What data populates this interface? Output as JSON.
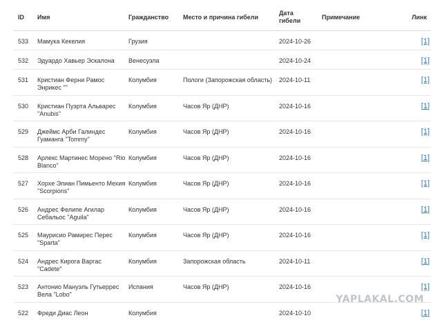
{
  "table": {
    "headers": {
      "id": "ID",
      "name": "Имя",
      "citizenship": "Гражданство",
      "place": "Место и причина гибели",
      "date_line1": "Дата",
      "date_line2": "гибели",
      "note": "Примечание",
      "link": "Линк"
    },
    "rows": [
      {
        "id": "533",
        "name": "Мамука Кекелия",
        "citizenship": "Грузия",
        "place": "",
        "date": "2024-10-26",
        "note": "",
        "link": "[1]"
      },
      {
        "id": "532",
        "name": "Эдуардо Хавьер Эскалона",
        "citizenship": "Венесуэла",
        "place": "",
        "date": "2024-10-24",
        "note": "",
        "link": "[1]"
      },
      {
        "id": "531",
        "name": "Кристиан Ферни Рамос Энрикес \"\"",
        "citizenship": "Колумбия",
        "place": "Пологи (Запорожская область)",
        "date": "2024-10-11",
        "note": "",
        "link": "[1]"
      },
      {
        "id": "530",
        "name": "Кристиан Пуэрта Альварес \"Anubis\"",
        "citizenship": "Колумбия",
        "place": "Часов Яр (ДНР)",
        "date": "2024-10-16",
        "note": "",
        "link": "[1]"
      },
      {
        "id": "529",
        "name": "Джеймс Арби Галиндес Гуаманга \"Tommy\"",
        "citizenship": "Колумбия",
        "place": "Часов Яр (ДНР)",
        "date": "2024-10-16",
        "note": "",
        "link": "[1]"
      },
      {
        "id": "528",
        "name": "Арлекс Мартинес Морено \"Rio Blanco\"",
        "citizenship": "Колумбия",
        "place": "Часов Яр (ДНР)",
        "date": "2024-10-16",
        "note": "",
        "link": "[1]"
      },
      {
        "id": "527",
        "name": "Хорхе Элиан Пимьенто Мехия \"Scorpions\"",
        "citizenship": "Колумбия",
        "place": "Часов Яр (ДНР)",
        "date": "2024-10-16",
        "note": "",
        "link": "[1]"
      },
      {
        "id": "526",
        "name": "Андрес Фелипе Агилар Себальос \"Aguila\"",
        "citizenship": "Колумбия",
        "place": "Часов Яр (ДНР)",
        "date": "2024-10-16",
        "note": "",
        "link": "[1]"
      },
      {
        "id": "525",
        "name": "Маурисио Рамирес Перес \"Sparta\"",
        "citizenship": "Колумбия",
        "place": "Часов Яр (ДНР)",
        "date": "2024-10-16",
        "note": "",
        "link": "[1]"
      },
      {
        "id": "524",
        "name": "Андрес Кирога Варгас \"Cadete\"",
        "citizenship": "Колумбия",
        "place": "Запорожская область",
        "date": "2024-10-11",
        "note": "",
        "link": "[1]"
      },
      {
        "id": "523",
        "name": "Антонио Мануэль Гутьеррес Вела \"Lobo\"",
        "citizenship": "Испания",
        "place": "Часов Яр (ДНР)",
        "date": "2024-10-16",
        "note": "",
        "link": "[1]"
      },
      {
        "id": "522",
        "name": "Фреди Диас Леон",
        "citizenship": "Колумбия",
        "place": "",
        "date": "2024-10-10",
        "note": "",
        "link": "[1]"
      }
    ]
  },
  "watermark": "YAPLAKAL.COM",
  "colors": {
    "link": "#2e7bbf",
    "text": "#333333",
    "divider": "#e5e5e5"
  }
}
